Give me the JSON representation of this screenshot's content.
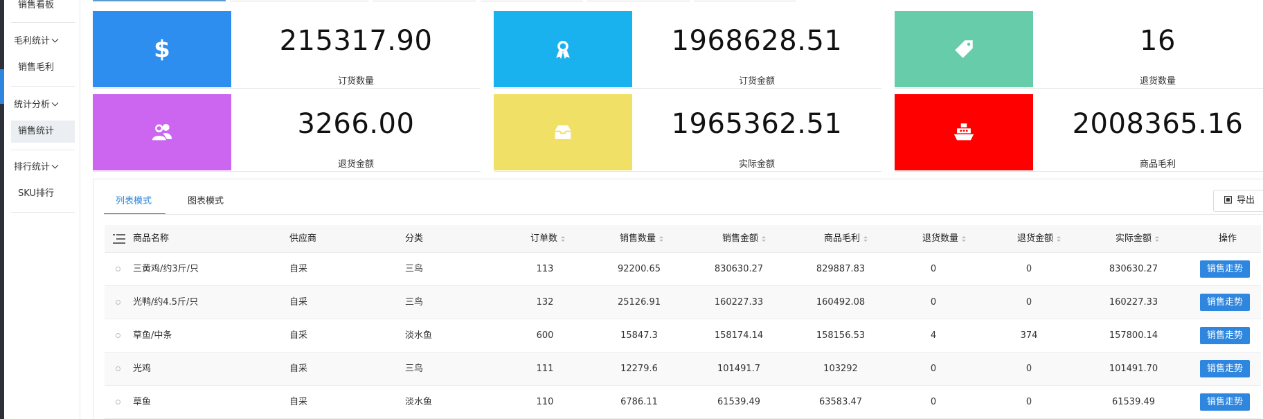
{
  "sidebar": {
    "top_item": "销售看板",
    "groups": [
      {
        "label": "毛利统计",
        "items": [
          "销售毛利"
        ]
      },
      {
        "label": "统计分析",
        "items": [
          "销售统计"
        ]
      },
      {
        "label": "排行统计",
        "items": [
          "SKU排行"
        ]
      }
    ]
  },
  "cards": [
    {
      "value": "215317.90",
      "label": "订货数量",
      "icon": "dollar-icon",
      "color": "#2e8ef0"
    },
    {
      "value": "1968628.51",
      "label": "订货金额",
      "icon": "award-icon",
      "color": "#19b2ee"
    },
    {
      "value": "16",
      "label": "退货数量",
      "icon": "tag-icon",
      "color": "#66ccaa"
    },
    {
      "value": "3266.00",
      "label": "退货金额",
      "icon": "users-icon",
      "color": "#cc66f0"
    },
    {
      "value": "1965362.51",
      "label": "实际金额",
      "icon": "inbox-icon",
      "color": "#f0e066"
    },
    {
      "value": "2008365.16",
      "label": "商品毛利",
      "icon": "ship-icon",
      "color": "#ff0000"
    }
  ],
  "mode_tabs": [
    "列表模式",
    "图表模式"
  ],
  "export_label": "导出",
  "table": {
    "headers": [
      "商品名称",
      "供应商",
      "分类",
      "订单数",
      "销售数量",
      "销售金额",
      "商品毛利",
      "退货数量",
      "退货金额",
      "实际金额",
      "操作"
    ],
    "rows": [
      [
        "三黄鸡/约3斤/只",
        "自采",
        "三鸟",
        "113",
        "92200.65",
        "830630.27",
        "829887.83",
        "0",
        "0",
        "830630.27"
      ],
      [
        "光鸭/约4.5斤/只",
        "自采",
        "三鸟",
        "132",
        "25126.91",
        "160227.33",
        "160492.08",
        "0",
        "0",
        "160227.33"
      ],
      [
        "草鱼/中条",
        "自采",
        "淡水鱼",
        "600",
        "15847.3",
        "158174.14",
        "158156.53",
        "4",
        "374",
        "157800.14"
      ],
      [
        "光鸡",
        "自采",
        "三鸟",
        "111",
        "12279.6",
        "101491.7",
        "103292",
        "0",
        "0",
        "101491.70"
      ],
      [
        "草鱼",
        "自采",
        "淡水鱼",
        "110",
        "6786.11",
        "61539.49",
        "63583.47",
        "0",
        "0",
        "61539.49"
      ]
    ],
    "action_label": "销售走势"
  }
}
